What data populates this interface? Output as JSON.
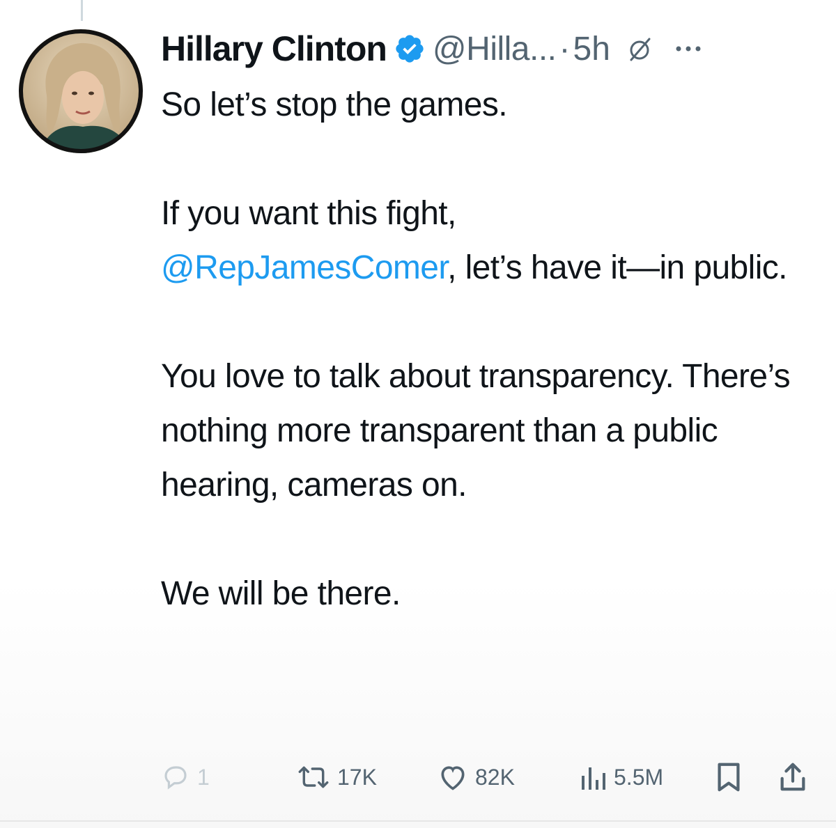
{
  "tweet": {
    "author": {
      "display_name": "Hillary Clinton",
      "handle": "@Hilla...",
      "verified": true,
      "avatar_icon": "profile-photo"
    },
    "separator": "·",
    "timestamp": "5h",
    "body": {
      "p1": "So let’s stop the games.",
      "p2_prefix": "If you want this fight,",
      "p2_mention": "@RepJamesComer",
      "p2_suffix": ", let’s have it—in public.",
      "p3": "You love to talk about transparency. There’s nothing more transparent than a public hearing, cameras on.",
      "p4": "We will be there."
    },
    "actions": {
      "replies": "1",
      "reposts": "17K",
      "likes": "82K",
      "views": "5.5M"
    }
  },
  "colors": {
    "text": "#0f1419",
    "secondary": "#536471",
    "link": "#1d9bf0",
    "verified": "#1d9bf0"
  },
  "icons": {
    "verified": "verified-badge-icon",
    "grok": "grok-icon",
    "more": "more-icon",
    "reply": "reply-icon",
    "repost": "repost-icon",
    "like": "heart-icon",
    "views": "views-chart-icon",
    "bookmark": "bookmark-icon",
    "share": "share-icon"
  }
}
